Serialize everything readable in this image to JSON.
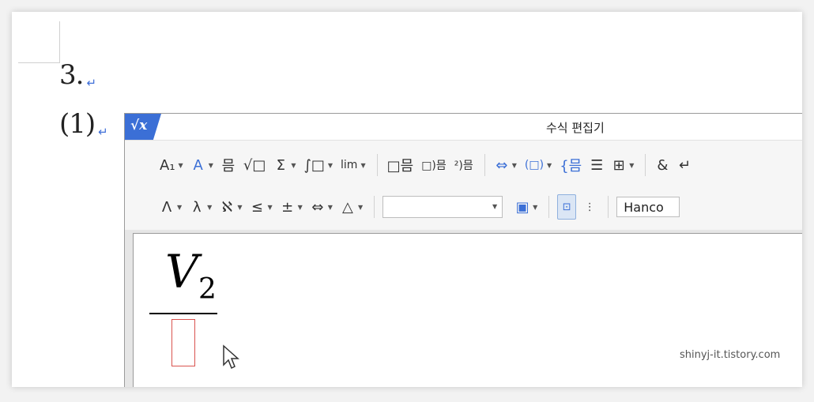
{
  "document": {
    "line1": "3.",
    "line2": "(1)",
    "return_mark": "↵"
  },
  "editor": {
    "title": "수식 편집기",
    "logo": "√x",
    "toolbar_row1": [
      {
        "icon": "font-size-icon",
        "glyph": "A₁",
        "dropdown": true
      },
      {
        "icon": "decoration-icon",
        "glyph": "A",
        "dropdown": true
      },
      {
        "icon": "fraction-icon",
        "glyph": "믐",
        "dropdown": false
      },
      {
        "icon": "root-icon",
        "glyph": "√□",
        "dropdown": false
      },
      {
        "icon": "sum-icon",
        "glyph": "Σ",
        "dropdown": true
      },
      {
        "icon": "integral-icon",
        "glyph": "∫□",
        "dropdown": true
      },
      {
        "icon": "limit-icon",
        "glyph": "lim",
        "dropdown": true
      },
      {
        "icon": "matrix-left-icon",
        "glyph": "□믐",
        "dropdown": false
      },
      {
        "icon": "matrix-mid-icon",
        "glyph": "□)믐",
        "dropdown": false
      },
      {
        "icon": "matrix-right-icon",
        "glyph": "²)믐",
        "dropdown": false
      },
      {
        "icon": "arrow-fraction-icon",
        "glyph": "⇔",
        "dropdown": true
      },
      {
        "icon": "paren-icon",
        "glyph": "(□)",
        "dropdown": true
      },
      {
        "icon": "brace-icon",
        "glyph": "{믐",
        "dropdown": false
      },
      {
        "icon": "rows-icon",
        "glyph": "☰",
        "dropdown": false
      },
      {
        "icon": "grid-icon",
        "glyph": "⊞",
        "dropdown": true
      },
      {
        "icon": "ampersand-icon",
        "glyph": "&",
        "dropdown": false
      },
      {
        "icon": "enter-icon",
        "glyph": "↵",
        "dropdown": false
      }
    ],
    "toolbar_row2": [
      {
        "icon": "greek-upper-icon",
        "glyph": "Λ",
        "dropdown": true
      },
      {
        "icon": "greek-lower-icon",
        "glyph": "λ",
        "dropdown": true
      },
      {
        "icon": "hebrew-icon",
        "glyph": "ℵ",
        "dropdown": true
      },
      {
        "icon": "relation-icon",
        "glyph": "≤",
        "dropdown": true
      },
      {
        "icon": "operator-icon",
        "glyph": "±",
        "dropdown": true
      },
      {
        "icon": "arrow-icon",
        "glyph": "⇔",
        "dropdown": true
      },
      {
        "icon": "misc-symbol-icon",
        "glyph": "△",
        "dropdown": true
      }
    ],
    "font_combo_value": "",
    "font_name": "Hanco",
    "equation": {
      "numerator_var": "V",
      "numerator_sub": "2"
    }
  },
  "watermark": "shinyj-it.tistory.com"
}
